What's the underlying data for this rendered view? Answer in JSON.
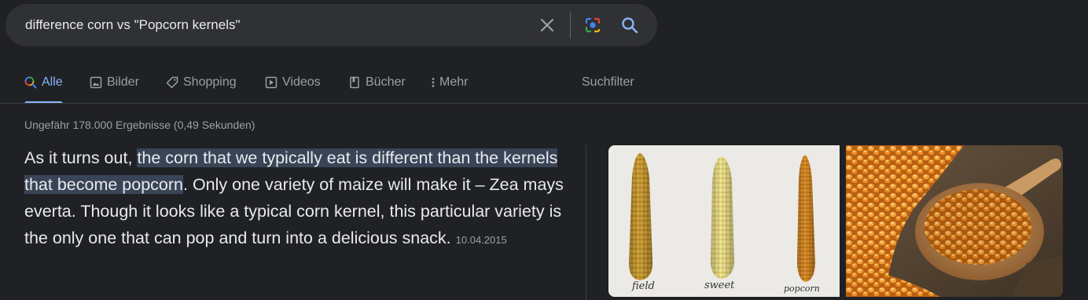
{
  "search": {
    "query": "difference corn vs \"Popcorn kernels\""
  },
  "tabs": [
    {
      "label": "Alle",
      "icon": "search-icon",
      "active": true
    },
    {
      "label": "Bilder",
      "icon": "image-icon",
      "active": false
    },
    {
      "label": "Shopping",
      "icon": "tag-icon",
      "active": false
    },
    {
      "label": "Videos",
      "icon": "play-icon",
      "active": false
    },
    {
      "label": "Bücher",
      "icon": "book-icon",
      "active": false
    },
    {
      "label": "Mehr",
      "icon": "more-vert-icon",
      "active": false
    }
  ],
  "tools_label": "Suchfilter",
  "result_stats": "Ungefähr 178.000 Ergebnisse (0,49 Sekunden)",
  "snippet": {
    "prefix": "As it turns out, ",
    "highlight": "the corn that we typically eat is different than the kernels that become popcorn",
    "suffix": ". Only one variety of maize will make it – Zea mays everta. Though it looks like a typical corn kernel, this particular variety is the only one that can pop and turn into a delicious snack.",
    "date": "10.04.2015"
  },
  "images": {
    "corn_labels": [
      "field",
      "sweet",
      "popcorn"
    ]
  },
  "colors": {
    "background": "#202124",
    "accent": "#8ab4f8",
    "highlight": "#394457"
  }
}
